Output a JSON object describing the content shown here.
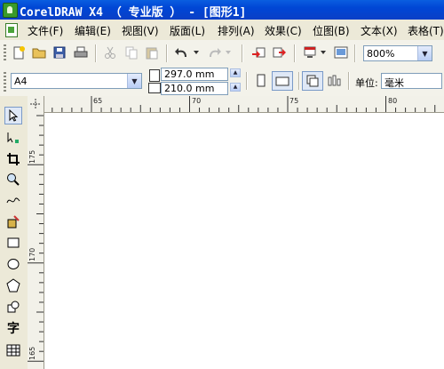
{
  "window": {
    "title": "CorelDRAW X4 （ 专业版 ） - [图形1]"
  },
  "menu": {
    "items": [
      {
        "label": "文件(F)"
      },
      {
        "label": "编辑(E)"
      },
      {
        "label": "视图(V)"
      },
      {
        "label": "版面(L)"
      },
      {
        "label": "排列(A)"
      },
      {
        "label": "效果(C)"
      },
      {
        "label": "位图(B)"
      },
      {
        "label": "文本(X)"
      },
      {
        "label": "表格(T)"
      }
    ]
  },
  "toolbar": {
    "zoom_value": "800%"
  },
  "property_bar": {
    "page_size": "A4",
    "width_value": "297.0 mm",
    "height_value": "210.0 mm",
    "units_label": "单位:",
    "units_value": "毫米"
  },
  "rulers": {
    "horizontal_labels": [
      "65",
      "70",
      "75",
      "80"
    ],
    "vertical_labels": [
      "175",
      "170",
      "165"
    ]
  },
  "toolbox": {
    "text_tool_glyph": "字"
  },
  "colors": {
    "title_bar": "#0a5ee0",
    "chrome": "#ece9d8",
    "canvas": "#ffffff"
  }
}
